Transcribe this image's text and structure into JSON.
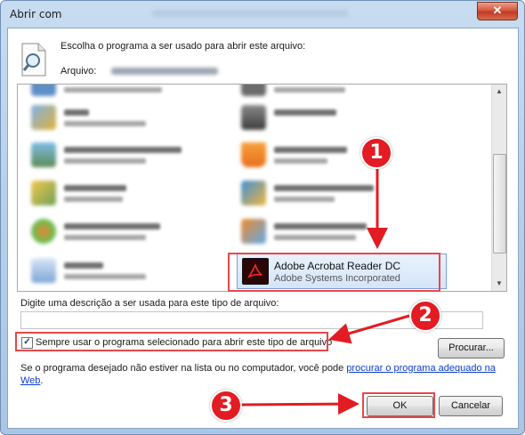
{
  "window": {
    "title": "Abrir com",
    "close_symbol": "✕"
  },
  "header": {
    "prompt": "Escolha o programa a ser usado para abrir este arquivo:",
    "file_label": "Arquivo:"
  },
  "program_list": {
    "selected": {
      "name": "Adobe Acrobat Reader DC",
      "publisher": "Adobe Systems Incorporated"
    }
  },
  "description": {
    "label": "Digite uma descrição a ser usada para este tipo de arquivo:",
    "value": ""
  },
  "always_use": {
    "label": "Sempre usar o programa selecionado para abrir este tipo de arquivo",
    "checked": true,
    "check_symbol": "✓"
  },
  "buttons": {
    "browse": "Procurar...",
    "ok": "OK",
    "cancel": "Cancelar"
  },
  "note": {
    "text": "Se o programa desejado não estiver na lista ou no computador, você pode ",
    "link": "procurar o programa adequado na Web",
    "end": "."
  },
  "markers": [
    "1",
    "2",
    "3"
  ],
  "colors": {
    "marker": "#e31b23",
    "highlight": "#e8474a",
    "link": "#0b3ccf"
  }
}
